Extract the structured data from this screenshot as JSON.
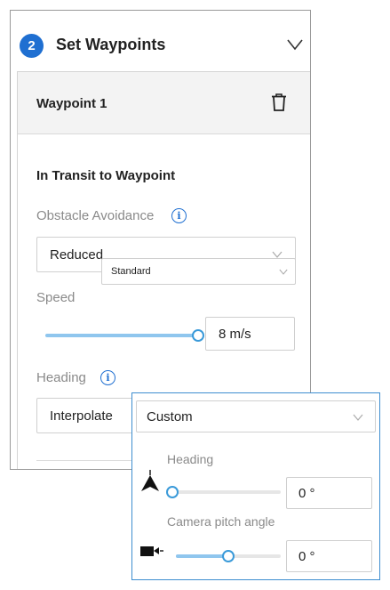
{
  "panel": {
    "step_number": "2",
    "title": "Set Waypoints"
  },
  "waypoint": {
    "title": "Waypoint 1",
    "section_title": "In Transit to Waypoint",
    "obstacle_avoidance": {
      "label": "Obstacle Avoidance",
      "selected": "Reduced"
    },
    "speed": {
      "label": "Speed",
      "value": "8 m/s",
      "slider_fraction": 1.0
    },
    "heading": {
      "label": "Heading",
      "selected": "Interpolate"
    }
  },
  "overlay_dropdown": {
    "selected": "Standard"
  },
  "heading_popup": {
    "selected": "Custom",
    "heading_label": "Heading",
    "heading_value": "0 °",
    "heading_slider_fraction": 0.0,
    "pitch_label": "Camera pitch angle",
    "pitch_value": "0 °",
    "pitch_slider_fraction": 0.5
  },
  "colors": {
    "accent": "#1f6fd1",
    "slider_fill": "#8fc6ee",
    "popup_border": "#3e8ed0"
  },
  "icons": {
    "collapse": "chevron-down-icon",
    "delete": "trash-icon",
    "info": "info-icon",
    "heading_direction": "arrow-up-icon",
    "camera": "video-camera-icon"
  }
}
